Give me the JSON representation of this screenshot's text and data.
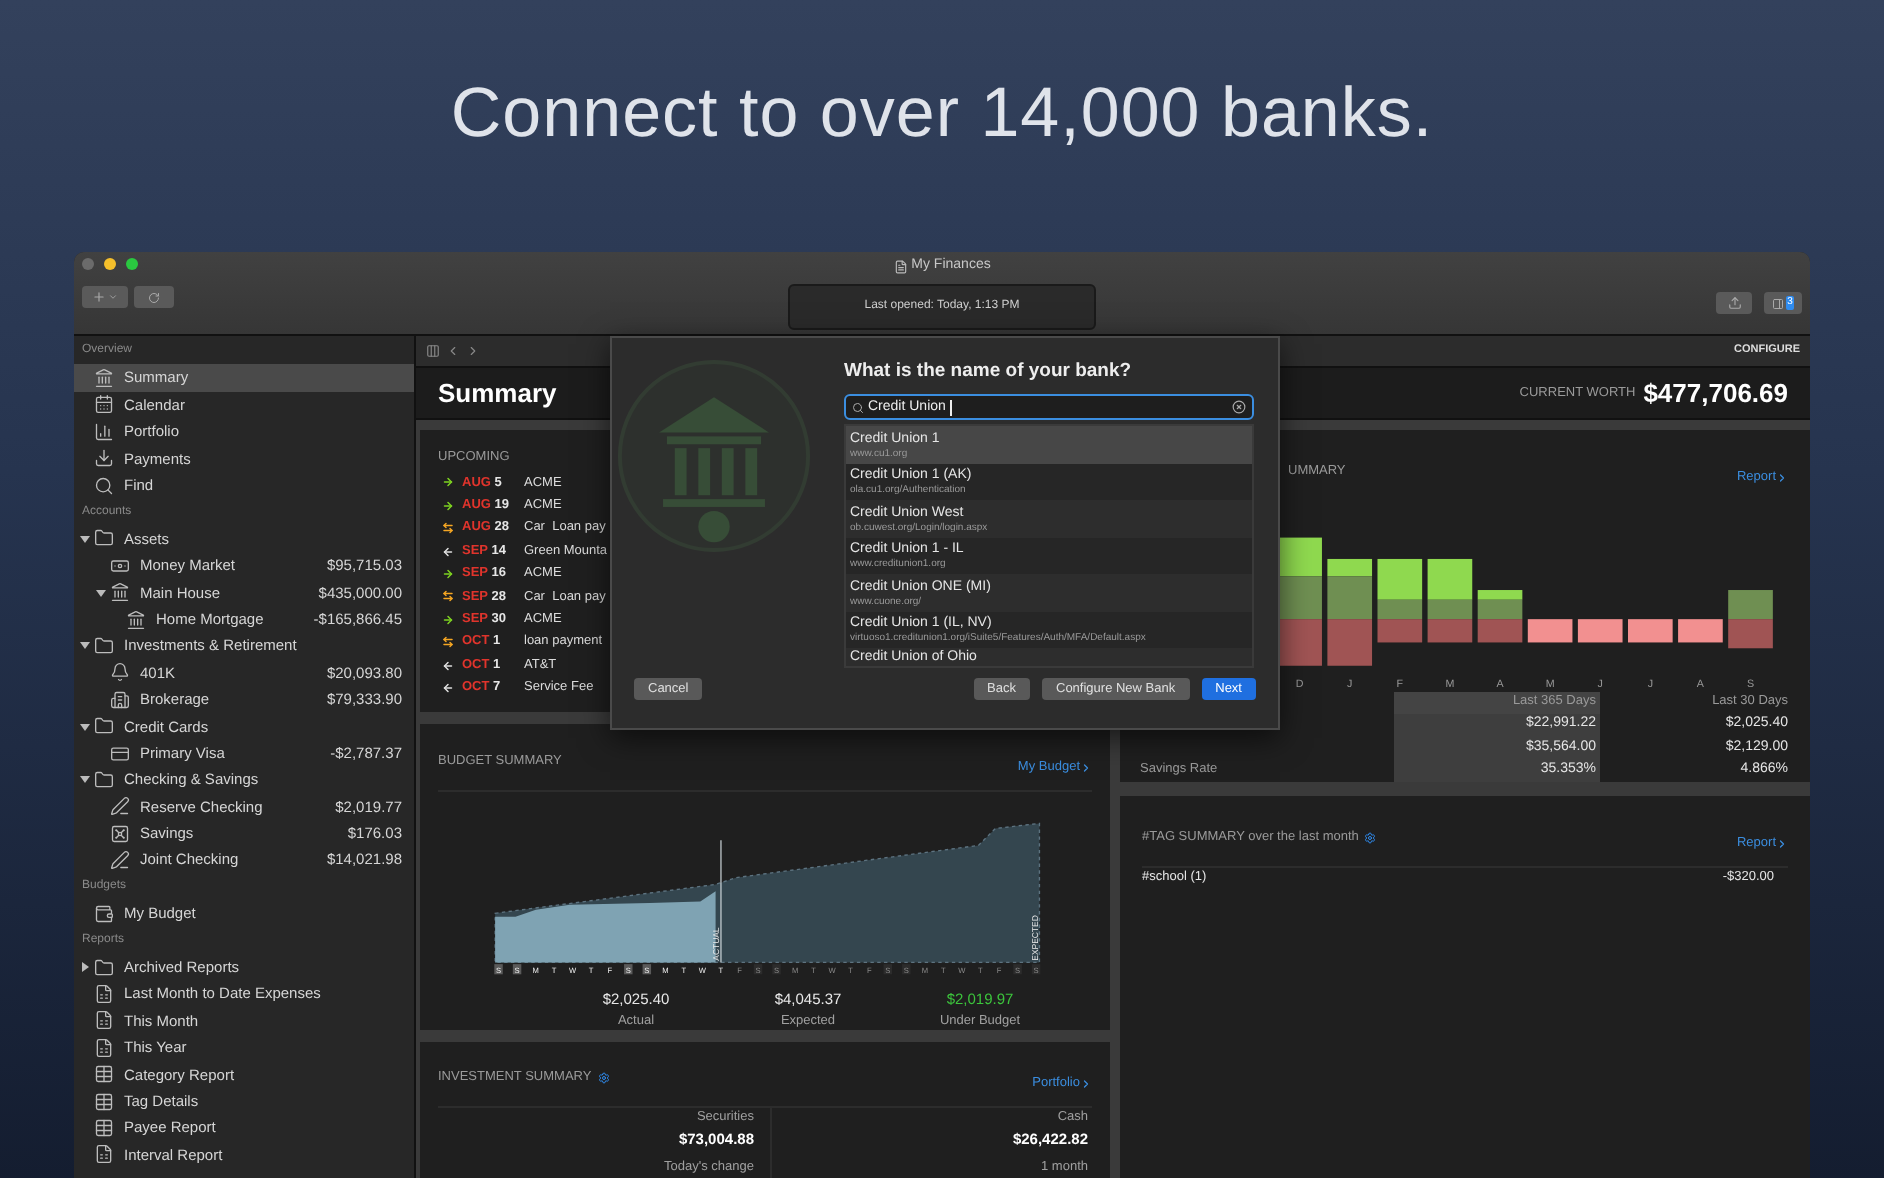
{
  "headline": "Connect to over 14,000 banks.",
  "window": {
    "title": "My Finances",
    "status": "Last opened: Today, 1:13 PM",
    "badge": "3"
  },
  "sidebar": {
    "sections": [
      {
        "label": "Overview",
        "items": [
          {
            "label": "Summary",
            "kind": "bank",
            "selected": true
          },
          {
            "label": "Calendar",
            "kind": "calendar",
            "selected": false
          },
          {
            "label": "Portfolio",
            "kind": "portfolio",
            "selected": false
          },
          {
            "label": "Payments",
            "kind": "payments",
            "selected": false
          },
          {
            "label": "Find",
            "kind": "find",
            "selected": false
          }
        ]
      },
      {
        "label": "Accounts",
        "items": [
          {
            "label": "Assets",
            "kind": "folder",
            "selected": false,
            "expanded": true,
            "children": [
              {
                "label": "Money Market",
                "kind": "cash",
                "amount": "$95,715.03",
                "selected": false
              },
              {
                "label": "Main House",
                "kind": "bank",
                "amount": "$435,000.00",
                "selected": false,
                "expanded": true,
                "children": [
                  {
                    "label": "Home Mortgage",
                    "kind": "bank",
                    "amount": "-$165,866.45",
                    "selected": false
                  }
                ]
              }
            ]
          },
          {
            "label": "Investments & Retirement",
            "kind": "folder",
            "selected": false,
            "expanded": true,
            "children": [
              {
                "label": "401K",
                "kind": "retirement",
                "amount": "$20,093.80",
                "selected": false
              },
              {
                "label": "Brokerage",
                "kind": "brokerage",
                "amount": "$79,333.90",
                "selected": false
              }
            ]
          },
          {
            "label": "Credit Cards",
            "kind": "folder",
            "selected": false,
            "expanded": true,
            "children": [
              {
                "label": "Primary Visa",
                "kind": "card",
                "amount": "-$2,787.37",
                "selected": false
              }
            ]
          },
          {
            "label": "Checking & Savings",
            "kind": "folder",
            "selected": false,
            "expanded": true,
            "children": [
              {
                "label": "Reserve Checking",
                "kind": "checking",
                "amount": "$2,019.77",
                "selected": false
              },
              {
                "label": "Savings",
                "kind": "savings",
                "amount": "$176.03",
                "selected": false
              },
              {
                "label": "Joint Checking",
                "kind": "checking",
                "amount": "$14,021.98",
                "selected": false
              }
            ]
          }
        ]
      },
      {
        "label": "Budgets",
        "items": [
          {
            "label": "My Budget",
            "kind": "budget",
            "selected": false
          }
        ]
      },
      {
        "label": "Reports",
        "items": [
          {
            "label": "Archived Reports",
            "kind": "folder",
            "selected": false,
            "expanded": false
          },
          {
            "label": "Last Month to Date Expenses",
            "kind": "report",
            "selected": false
          },
          {
            "label": "This Month",
            "kind": "report",
            "selected": false
          },
          {
            "label": "This Year",
            "kind": "report",
            "selected": false
          },
          {
            "label": "Category Report",
            "kind": "table",
            "selected": false
          },
          {
            "label": "Tag Details",
            "kind": "table",
            "selected": false
          },
          {
            "label": "Payee Report",
            "kind": "table",
            "selected": false
          },
          {
            "label": "Interval Report",
            "kind": "report",
            "selected": false
          }
        ]
      }
    ]
  },
  "header": {
    "configure": "CONFIGURE",
    "title": "Summary",
    "worth_label": "CURRENT WORTH",
    "worth": "$477,706.69"
  },
  "upcoming": {
    "title": "UPCOMING",
    "rows": [
      {
        "kind": "deposit",
        "month": "AUG",
        "day": "5",
        "payee": "ACME"
      },
      {
        "kind": "deposit",
        "month": "AUG",
        "day": "19",
        "payee": "ACME"
      },
      {
        "kind": "transfer",
        "month": "AUG",
        "day": "28",
        "payee": "Car  Loan pay"
      },
      {
        "kind": "payment",
        "month": "SEP",
        "day": "14",
        "payee": "Green Mounta"
      },
      {
        "kind": "deposit",
        "month": "SEP",
        "day": "16",
        "payee": "ACME"
      },
      {
        "kind": "transfer",
        "month": "SEP",
        "day": "28",
        "payee": "Car  Loan pay"
      },
      {
        "kind": "deposit",
        "month": "SEP",
        "day": "30",
        "payee": "ACME"
      },
      {
        "kind": "transfer",
        "month": "OCT",
        "day": "1",
        "payee": "loan payment"
      },
      {
        "kind": "payment",
        "month": "OCT",
        "day": "1",
        "payee": "AT&T"
      },
      {
        "kind": "payment",
        "month": "OCT",
        "day": "7",
        "payee": "Service Fee"
      }
    ]
  },
  "budget": {
    "title": "BUDGET SUMMARY",
    "link": "My Budget",
    "actual_marker": "ACTUAL",
    "expected_marker": "EXPECTED",
    "days": [
      {
        "label": "S",
        "past": true,
        "weekend": true
      },
      {
        "label": "S",
        "past": true,
        "weekend": true
      },
      {
        "label": "M",
        "past": true,
        "weekend": false
      },
      {
        "label": "T",
        "past": true,
        "weekend": false
      },
      {
        "label": "W",
        "past": true,
        "weekend": false
      },
      {
        "label": "T",
        "past": true,
        "weekend": false
      },
      {
        "label": "F",
        "past": true,
        "weekend": false
      },
      {
        "label": "S",
        "past": true,
        "weekend": true
      },
      {
        "label": "S",
        "past": true,
        "weekend": true
      },
      {
        "label": "M",
        "past": true,
        "weekend": false
      },
      {
        "label": "T",
        "past": true,
        "weekend": false
      },
      {
        "label": "W",
        "past": true,
        "weekend": false
      },
      {
        "label": "T",
        "past": true,
        "weekend": false
      },
      {
        "label": "F",
        "past": false,
        "weekend": false
      },
      {
        "label": "S",
        "past": false,
        "weekend": true
      },
      {
        "label": "S",
        "past": false,
        "weekend": true
      },
      {
        "label": "M",
        "past": false,
        "weekend": false
      },
      {
        "label": "T",
        "past": false,
        "weekend": false
      },
      {
        "label": "W",
        "past": false,
        "weekend": false
      },
      {
        "label": "T",
        "past": false,
        "weekend": false
      },
      {
        "label": "F",
        "past": false,
        "weekend": false
      },
      {
        "label": "S",
        "past": false,
        "weekend": true
      },
      {
        "label": "S",
        "past": false,
        "weekend": true
      },
      {
        "label": "M",
        "past": false,
        "weekend": false
      },
      {
        "label": "T",
        "past": false,
        "weekend": false
      },
      {
        "label": "W",
        "past": false,
        "weekend": false
      },
      {
        "label": "T",
        "past": false,
        "weekend": false
      },
      {
        "label": "F",
        "past": false,
        "weekend": false
      },
      {
        "label": "S",
        "past": false,
        "weekend": true
      },
      {
        "label": "S",
        "past": false,
        "weekend": true
      }
    ],
    "totals": [
      {
        "value": "$2,025.40",
        "label": "Actual",
        "kind": "plain"
      },
      {
        "value": "$4,045.37",
        "label": "Expected",
        "kind": "plain"
      },
      {
        "value": "$2,019.97",
        "label": "Under Budget",
        "kind": "positive"
      }
    ]
  },
  "investment": {
    "title": "INVESTMENT SUMMARY",
    "link": "Portfolio",
    "columns": [
      {
        "label": "Securities",
        "value": "$73,004.88",
        "sub": "Today's change"
      },
      {
        "label": "Cash",
        "value": "$26,422.82",
        "sub": "1 month"
      }
    ]
  },
  "income": {
    "title": "UMMARY",
    "link": "Report",
    "months": [
      "D",
      "J",
      "F",
      "M",
      "A",
      "M",
      "J",
      "J",
      "A",
      "S"
    ],
    "columns": [
      "Last 365 Days",
      "Last 30 Days"
    ],
    "rows": [
      {
        "values": [
          "$22,991.22",
          "$2,025.40"
        ]
      },
      {
        "values": [
          "$35,564.00",
          "$2,129.00"
        ]
      },
      {
        "label": "Savings Rate",
        "values": [
          "35.353%",
          "4.866%"
        ]
      }
    ]
  },
  "tags": {
    "title": "#TAG SUMMARY",
    "subtitle": "over the last month",
    "link": "Report",
    "rows": [
      {
        "tag": "#school (1)",
        "amount": "-$320.00"
      }
    ]
  },
  "dialog": {
    "title": "What is the name of your bank?",
    "query": "Credit Union",
    "results": [
      {
        "name": "Credit Union 1",
        "url": "www.cu1.org",
        "selected": true
      },
      {
        "name": "Credit Union 1 (AK)",
        "url": "ola.cu1.org/Authentication",
        "selected": false
      },
      {
        "name": "Credit Union West",
        "url": "ob.cuwest.org/Login/login.aspx",
        "selected": false
      },
      {
        "name": "Credit Union 1 - IL",
        "url": "www.creditunion1.org",
        "selected": false
      },
      {
        "name": "Credit Union ONE (MI)",
        "url": "www.cuone.org/",
        "selected": false
      },
      {
        "name": "Credit Union 1 (IL, NV)",
        "url": "virtuoso1.creditunion1.org/iSuite5/Features/Auth/MFA/Default.aspx",
        "selected": false
      },
      {
        "name": "Credit Union of Ohio",
        "selected": false
      }
    ],
    "buttons": [
      {
        "label": "Cancel",
        "kind": "cancel"
      },
      {
        "label": "Back",
        "kind": "plain"
      },
      {
        "label": "Configure New Bank",
        "kind": "plain"
      },
      {
        "label": "Next",
        "kind": "primary"
      }
    ]
  }
}
